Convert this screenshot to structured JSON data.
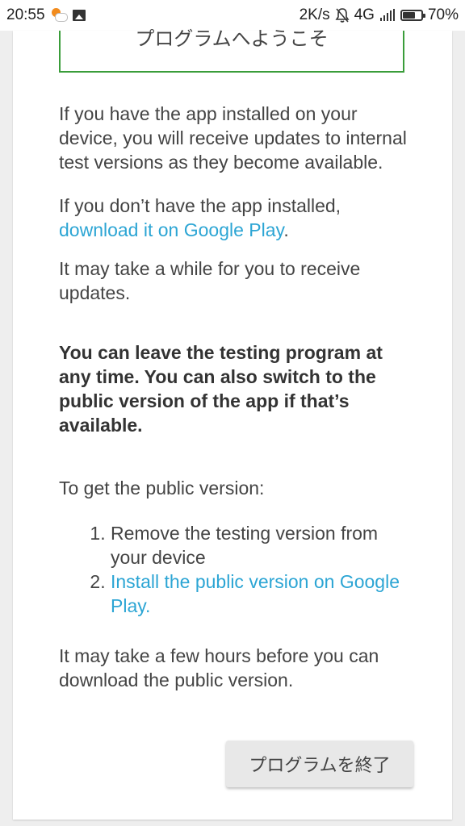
{
  "status_bar": {
    "time": "20:55",
    "net_speed": "2K/s",
    "network": "4G",
    "battery_percent": "70%",
    "battery_level": 0.7,
    "icons": [
      "weather-icon",
      "gallery-icon",
      "bell-off-icon",
      "signal-icon",
      "battery-icon"
    ]
  },
  "welcome": {
    "title": "プログラムへようこそ"
  },
  "body": {
    "p1": "If you have the app installed on your device, you will receive updates to internal test versions as they become available.",
    "p2_text": "If you don’t have the app installed, ",
    "p2_link": "download it on Google Play",
    "p2_end": ".",
    "p3": "It may take a while for you to receive updates.",
    "bold_text": "You can leave the testing program at any time. You can also switch to the public version of the app if that’s available.",
    "get_public": "To get the public version:",
    "steps": [
      "Remove the testing version from your device",
      "Install the public version on Google Play."
    ],
    "p_last": "It may take a few hours before you can download the public version."
  },
  "actions": {
    "end_program_label": "プログラムを終了"
  },
  "colors": {
    "link": "#2ca5d4",
    "welcome_border": "#3a9d3a"
  }
}
